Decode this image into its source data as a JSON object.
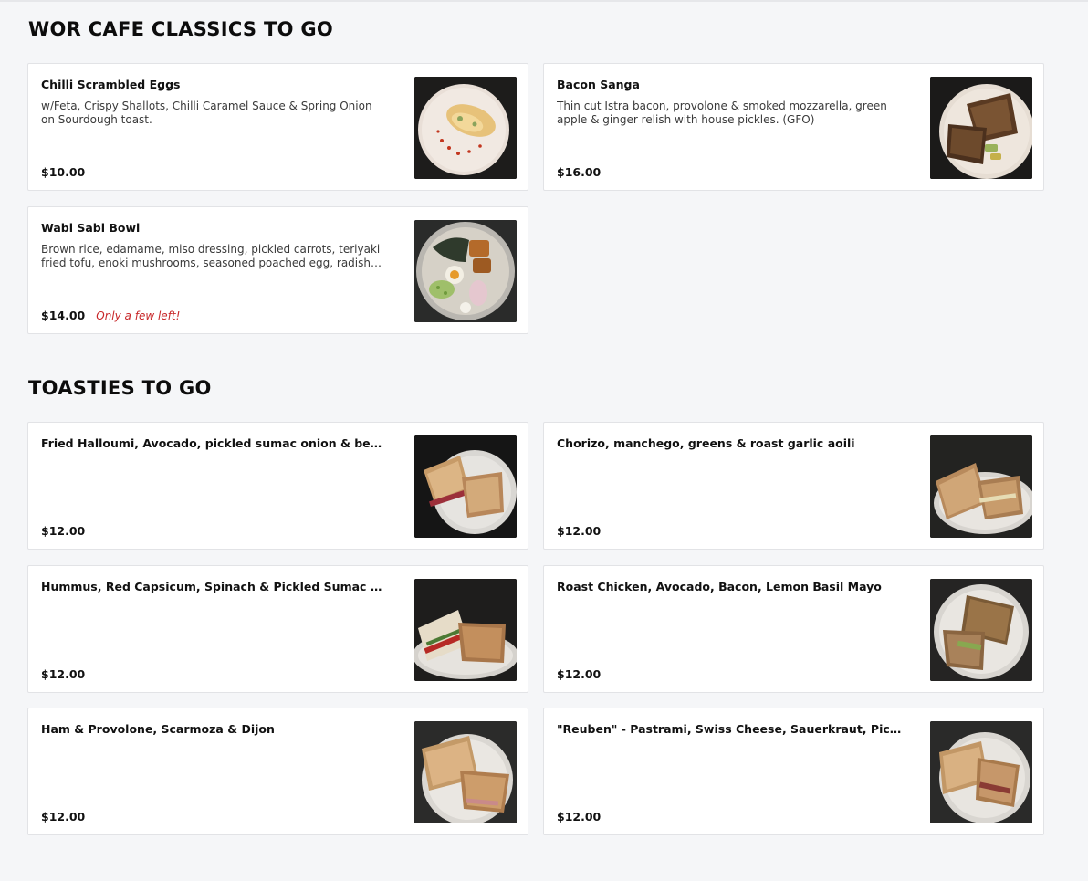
{
  "sections": [
    {
      "title": "WOR CAFE CLASSICS TO GO",
      "items": [
        {
          "name": "Chilli Scrambled Eggs",
          "description": "w/Feta, Crispy Shallots, Chilli Caramel Sauce & Spring Onion on Sourdough toast.",
          "price": "$10.00",
          "note": "",
          "image": "scrambled-eggs-photo"
        },
        {
          "name": "Bacon Sanga",
          "description": "Thin cut Istra bacon, provolone & smoked mozzarella, green apple & ginger relish with house pickles. (GFO)",
          "price": "$16.00",
          "note": "",
          "image": "bacon-sandwich-photo"
        },
        {
          "name": "Wabi Sabi Bowl",
          "description": "Brown rice, edamame, miso dressing, pickled carrots, teriyaki fried tofu, enoki mushrooms, seasoned poached egg, radish charred...",
          "price": "$14.00",
          "note": "Only a few left!",
          "image": "rice-bowl-photo"
        }
      ]
    },
    {
      "title": "TOASTIES TO GO",
      "items": [
        {
          "name": "Fried Halloumi, Avocado, pickled sumac onion & beet relish",
          "description": "",
          "price": "$12.00",
          "note": "",
          "image": "toastie-photo"
        },
        {
          "name": "Chorizo, manchego, greens & roast garlic aoili",
          "description": "",
          "price": "$12.00",
          "note": "",
          "image": "toastie-photo"
        },
        {
          "name": "Hummus, Red Capsicum, Spinach & Pickled Sumac Onion",
          "description": "",
          "price": "$12.00",
          "note": "",
          "image": "toastie-photo"
        },
        {
          "name": "Roast Chicken, Avocado, Bacon, Lemon Basil Mayo",
          "description": "",
          "price": "$12.00",
          "note": "",
          "image": "toastie-photo"
        },
        {
          "name": "Ham & Provolone, Scarmoza & Dijon",
          "description": "",
          "price": "$12.00",
          "note": "",
          "image": "toastie-photo"
        },
        {
          "name": "\"Reuben\" - Pastrami, Swiss Cheese, Sauerkraut, Pickles &...",
          "description": "",
          "price": "$12.00",
          "note": "",
          "image": "toastie-photo"
        }
      ]
    }
  ],
  "colors": {
    "background": "#f5f6f8",
    "card": "#ffffff",
    "note": "#c8282a"
  }
}
